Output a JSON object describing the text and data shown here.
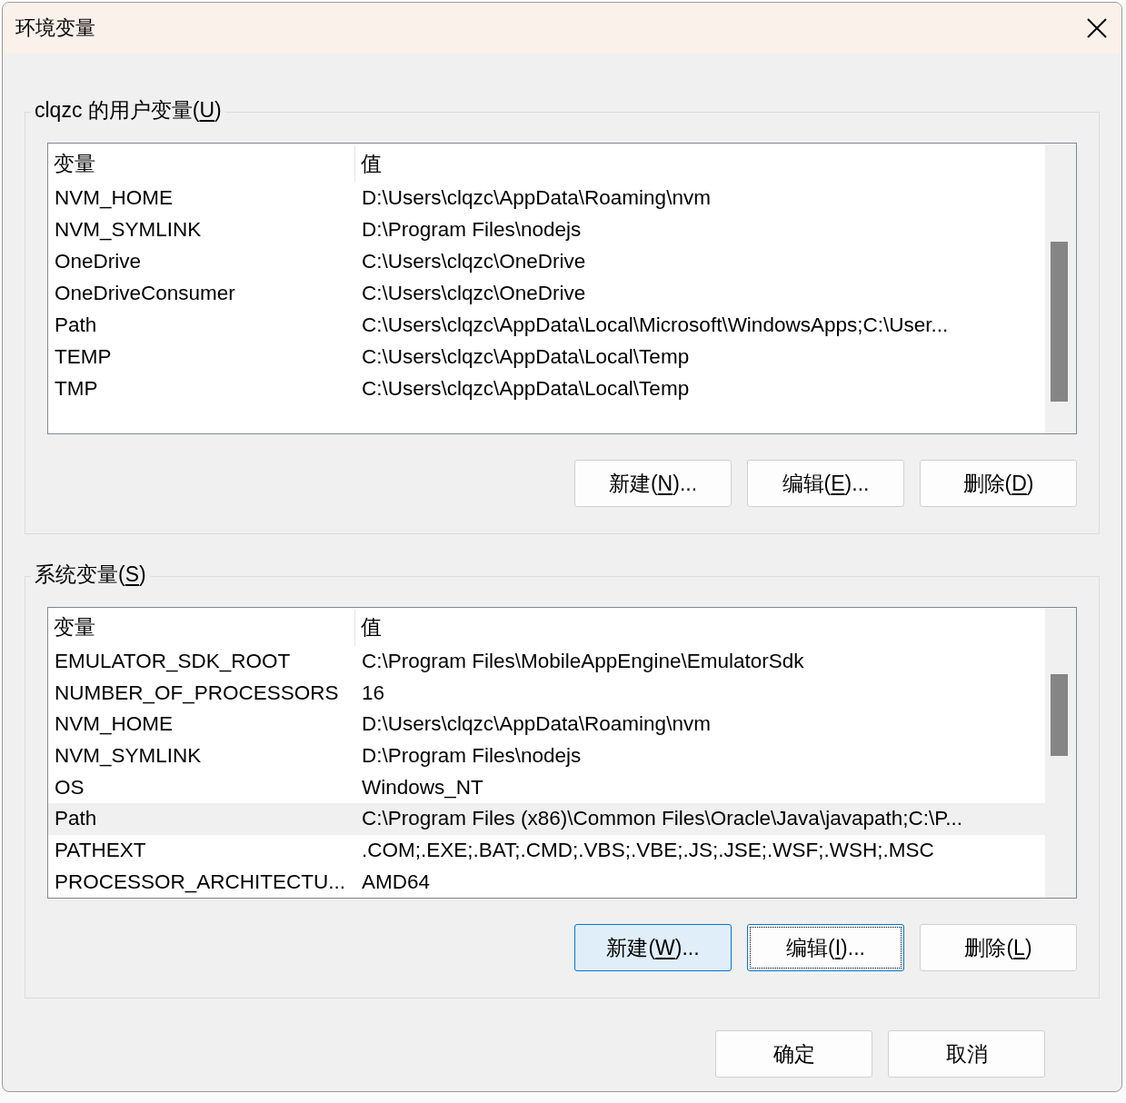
{
  "window": {
    "title": "环境变量"
  },
  "groups": [
    {
      "title_before": "clqzc 的用户变量(",
      "title_key": "U",
      "title_after": ")",
      "columns": [
        "变量",
        "值"
      ],
      "rows": [
        {
          "name": "NVM_HOME",
          "value": "D:\\Users\\clqzc\\AppData\\Roaming\\nvm",
          "selected": false
        },
        {
          "name": "NVM_SYMLINK",
          "value": "D:\\Program Files\\nodejs",
          "selected": false
        },
        {
          "name": "OneDrive",
          "value": "C:\\Users\\clqzc\\OneDrive",
          "selected": false
        },
        {
          "name": "OneDriveConsumer",
          "value": "C:\\Users\\clqzc\\OneDrive",
          "selected": false
        },
        {
          "name": "Path",
          "value": "C:\\Users\\clqzc\\AppData\\Local\\Microsoft\\WindowsApps;C:\\User...",
          "selected": false
        },
        {
          "name": "TEMP",
          "value": "C:\\Users\\clqzc\\AppData\\Local\\Temp",
          "selected": false
        },
        {
          "name": "TMP",
          "value": "C:\\Users\\clqzc\\AppData\\Local\\Temp",
          "selected": false
        }
      ],
      "buttons": [
        {
          "before": "新建(",
          "key": "N",
          "after": ")...",
          "hovered": false,
          "focused": false
        },
        {
          "before": "编辑(",
          "key": "E",
          "after": ")...",
          "hovered": false,
          "focused": false
        },
        {
          "before": "删除(",
          "key": "D",
          "after": ")",
          "hovered": false,
          "focused": false
        }
      ]
    },
    {
      "title_before": "系统变量(",
      "title_key": "S",
      "title_after": ")",
      "columns": [
        "变量",
        "值"
      ],
      "rows": [
        {
          "name": "EMULATOR_SDK_ROOT",
          "value": "C:\\Program Files\\MobileAppEngine\\EmulatorSdk",
          "selected": false
        },
        {
          "name": "NUMBER_OF_PROCESSORS",
          "value": "16",
          "selected": false
        },
        {
          "name": "NVM_HOME",
          "value": "D:\\Users\\clqzc\\AppData\\Roaming\\nvm",
          "selected": false
        },
        {
          "name": "NVM_SYMLINK",
          "value": "D:\\Program Files\\nodejs",
          "selected": false
        },
        {
          "name": "OS",
          "value": "Windows_NT",
          "selected": false
        },
        {
          "name": "Path",
          "value": "C:\\Program Files (x86)\\Common Files\\Oracle\\Java\\javapath;C:\\P...",
          "selected": true
        },
        {
          "name": "PATHEXT",
          "value": ".COM;.EXE;.BAT;.CMD;.VBS;.VBE;.JS;.JSE;.WSF;.WSH;.MSC",
          "selected": false
        },
        {
          "name": "PROCESSOR_ARCHITECTU...",
          "value": "AMD64",
          "selected": false
        }
      ],
      "buttons": [
        {
          "before": "新建(",
          "key": "W",
          "after": ")...",
          "hovered": true,
          "focused": false
        },
        {
          "before": "编辑(",
          "key": "I",
          "after": ")...",
          "hovered": false,
          "focused": true
        },
        {
          "before": "删除(",
          "key": "L",
          "after": ")",
          "hovered": false,
          "focused": false
        }
      ]
    }
  ],
  "footer_buttons": [
    "确定",
    "取消"
  ]
}
